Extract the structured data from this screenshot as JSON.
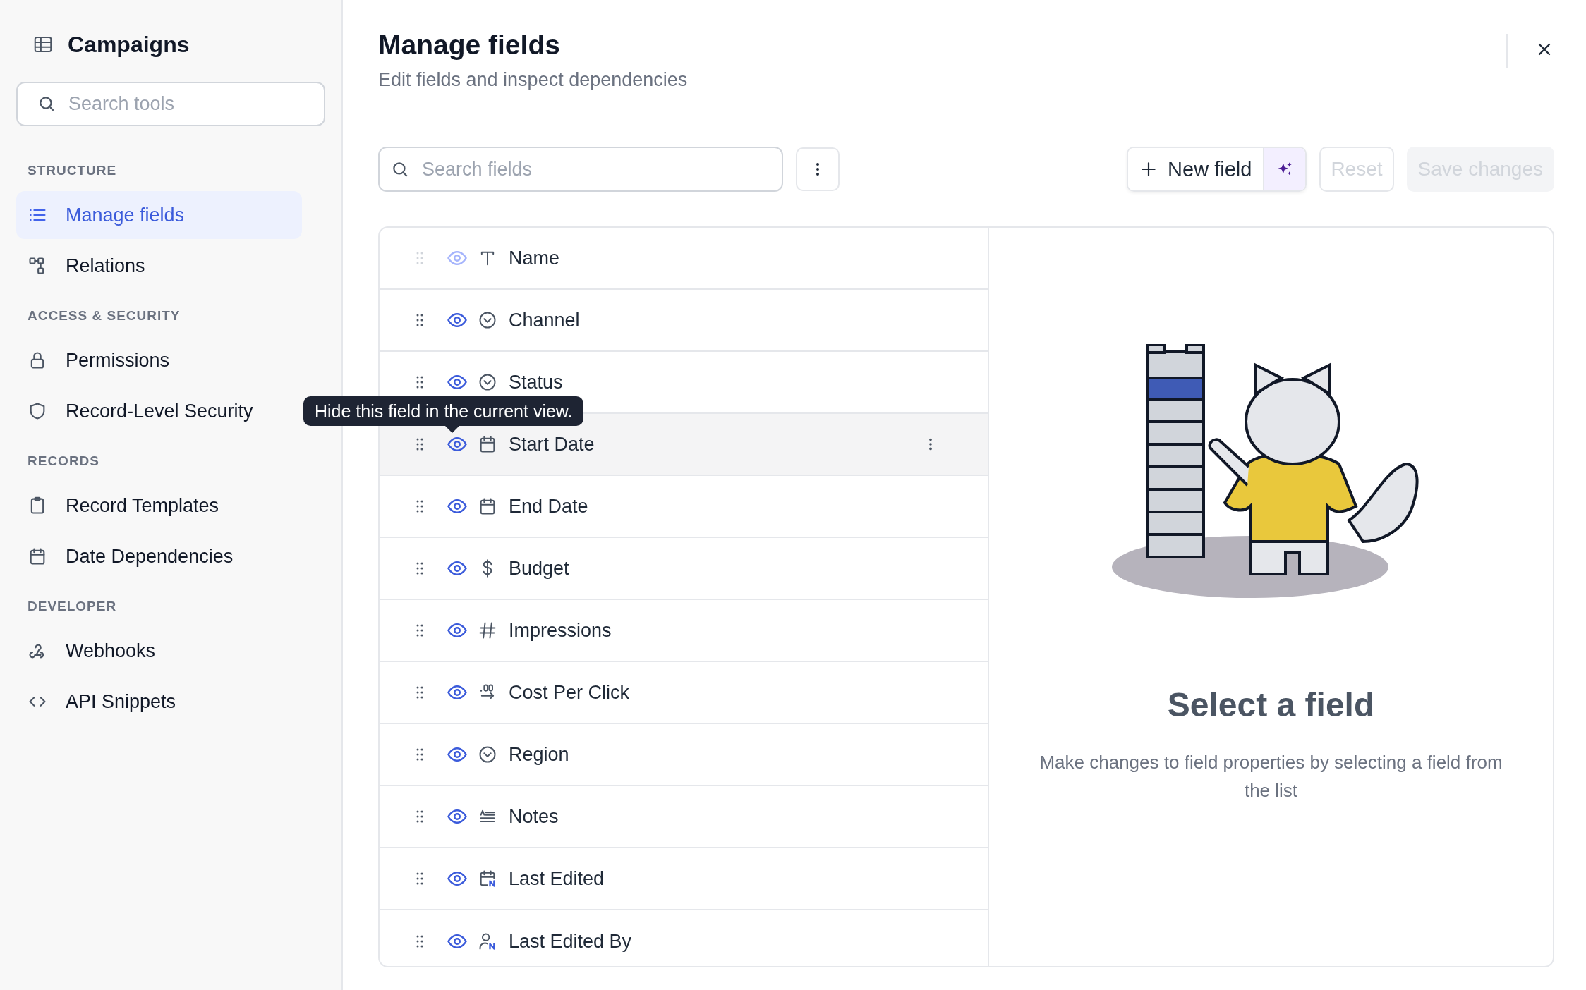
{
  "sidebar": {
    "title": "Campaigns",
    "search": {
      "placeholder": "Search tools"
    },
    "sections": [
      {
        "label": "STRUCTURE",
        "items": [
          {
            "label": "Manage fields",
            "kind": "list",
            "selected": true
          },
          {
            "label": "Relations",
            "kind": "relations",
            "selected": false
          }
        ]
      },
      {
        "label": "ACCESS & SECURITY",
        "items": [
          {
            "label": "Permissions",
            "kind": "lock",
            "selected": false
          },
          {
            "label": "Record-Level Security",
            "kind": "shield",
            "selected": false
          }
        ]
      },
      {
        "label": "RECORDS",
        "items": [
          {
            "label": "Record Templates",
            "kind": "clipboard",
            "selected": false
          },
          {
            "label": "Date Dependencies",
            "kind": "calendar",
            "selected": false
          }
        ]
      },
      {
        "label": "DEVELOPER",
        "items": [
          {
            "label": "Webhooks",
            "kind": "webhook",
            "selected": false
          },
          {
            "label": "API Snippets",
            "kind": "code",
            "selected": false
          }
        ]
      }
    ]
  },
  "main": {
    "title": "Manage fields",
    "subtitle": "Edit fields and inspect dependencies",
    "search": {
      "placeholder": "Search fields"
    },
    "new_field": {
      "label": "New field"
    },
    "buttons": [
      {
        "label": "Reset",
        "kind": "outline",
        "disabled": true
      },
      {
        "label": "Save changes",
        "kind": "primary",
        "disabled": true
      }
    ],
    "fields": [
      {
        "name": "Name",
        "kind": "text",
        "locked": true,
        "hovered": false
      },
      {
        "name": "Channel",
        "kind": "select",
        "locked": false,
        "hovered": false
      },
      {
        "name": "Status",
        "kind": "select",
        "locked": false,
        "hovered": false
      },
      {
        "name": "Start Date",
        "kind": "date",
        "locked": false,
        "hovered": true
      },
      {
        "name": "End Date",
        "kind": "date",
        "locked": false,
        "hovered": false
      },
      {
        "name": "Budget",
        "kind": "currency",
        "locked": false,
        "hovered": false
      },
      {
        "name": "Impressions",
        "kind": "number",
        "locked": false,
        "hovered": false
      },
      {
        "name": "Cost Per Click",
        "kind": "decimal",
        "locked": false,
        "hovered": false
      },
      {
        "name": "Region",
        "kind": "select",
        "locked": false,
        "hovered": false
      },
      {
        "name": "Notes",
        "kind": "longtext",
        "locked": false,
        "hovered": false
      },
      {
        "name": "Last Edited",
        "kind": "lastedited",
        "locked": false,
        "hovered": false
      },
      {
        "name": "Last Edited By",
        "kind": "lasteditedby",
        "locked": false,
        "hovered": false
      }
    ],
    "tooltip": {
      "text": "Hide this field in the current view."
    },
    "detail": {
      "title": "Select a field",
      "description": "Make changes to field properties by selecting a field from the list"
    }
  }
}
